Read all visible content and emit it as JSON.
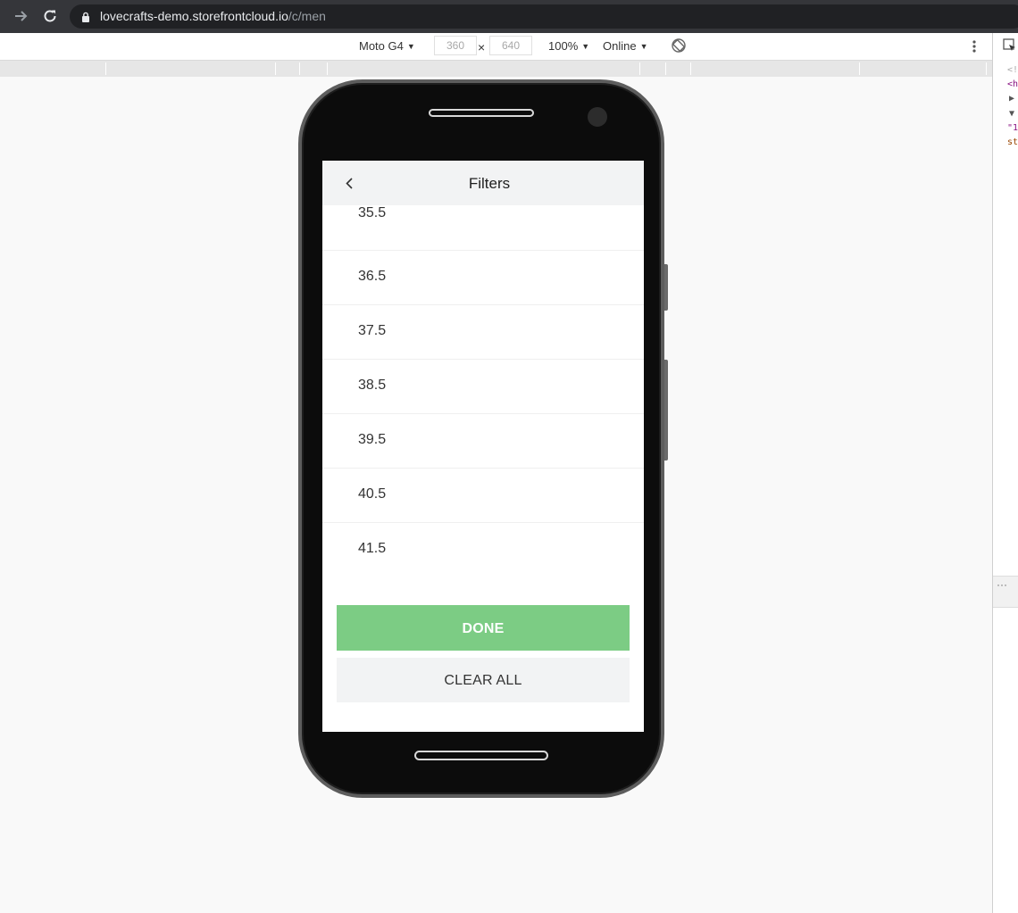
{
  "browser": {
    "url_host": "lovecrafts-demo.storefrontcloud.io",
    "url_path": "/c/men"
  },
  "device_toolbar": {
    "device": "Moto G4",
    "width": "360",
    "height": "640",
    "separator": "×",
    "zoom": "100%",
    "network": "Online"
  },
  "devtools_panel": {
    "lines": [
      "<!",
      "<h",
      "▶",
      "▼",
      "\"1",
      "st"
    ],
    "more": "···"
  },
  "filters": {
    "title": "Filters",
    "sizes": [
      "35.5",
      "36.5",
      "37.5",
      "38.5",
      "39.5",
      "40.5",
      "41.5"
    ],
    "done_label": "DONE",
    "clear_label": "CLEAR ALL"
  },
  "colors": {
    "done_bg": "#7ccc84",
    "header_bg": "#f2f3f4",
    "page_bg": "#f9f9f9"
  },
  "icons": {
    "back": "chevron-left-icon",
    "forward": "arrow-right-icon",
    "reload": "reload-icon",
    "lock": "lock-icon",
    "rotate": "rotate-icon",
    "more": "kebab-menu-icon",
    "inspect": "inspect-element-icon"
  }
}
